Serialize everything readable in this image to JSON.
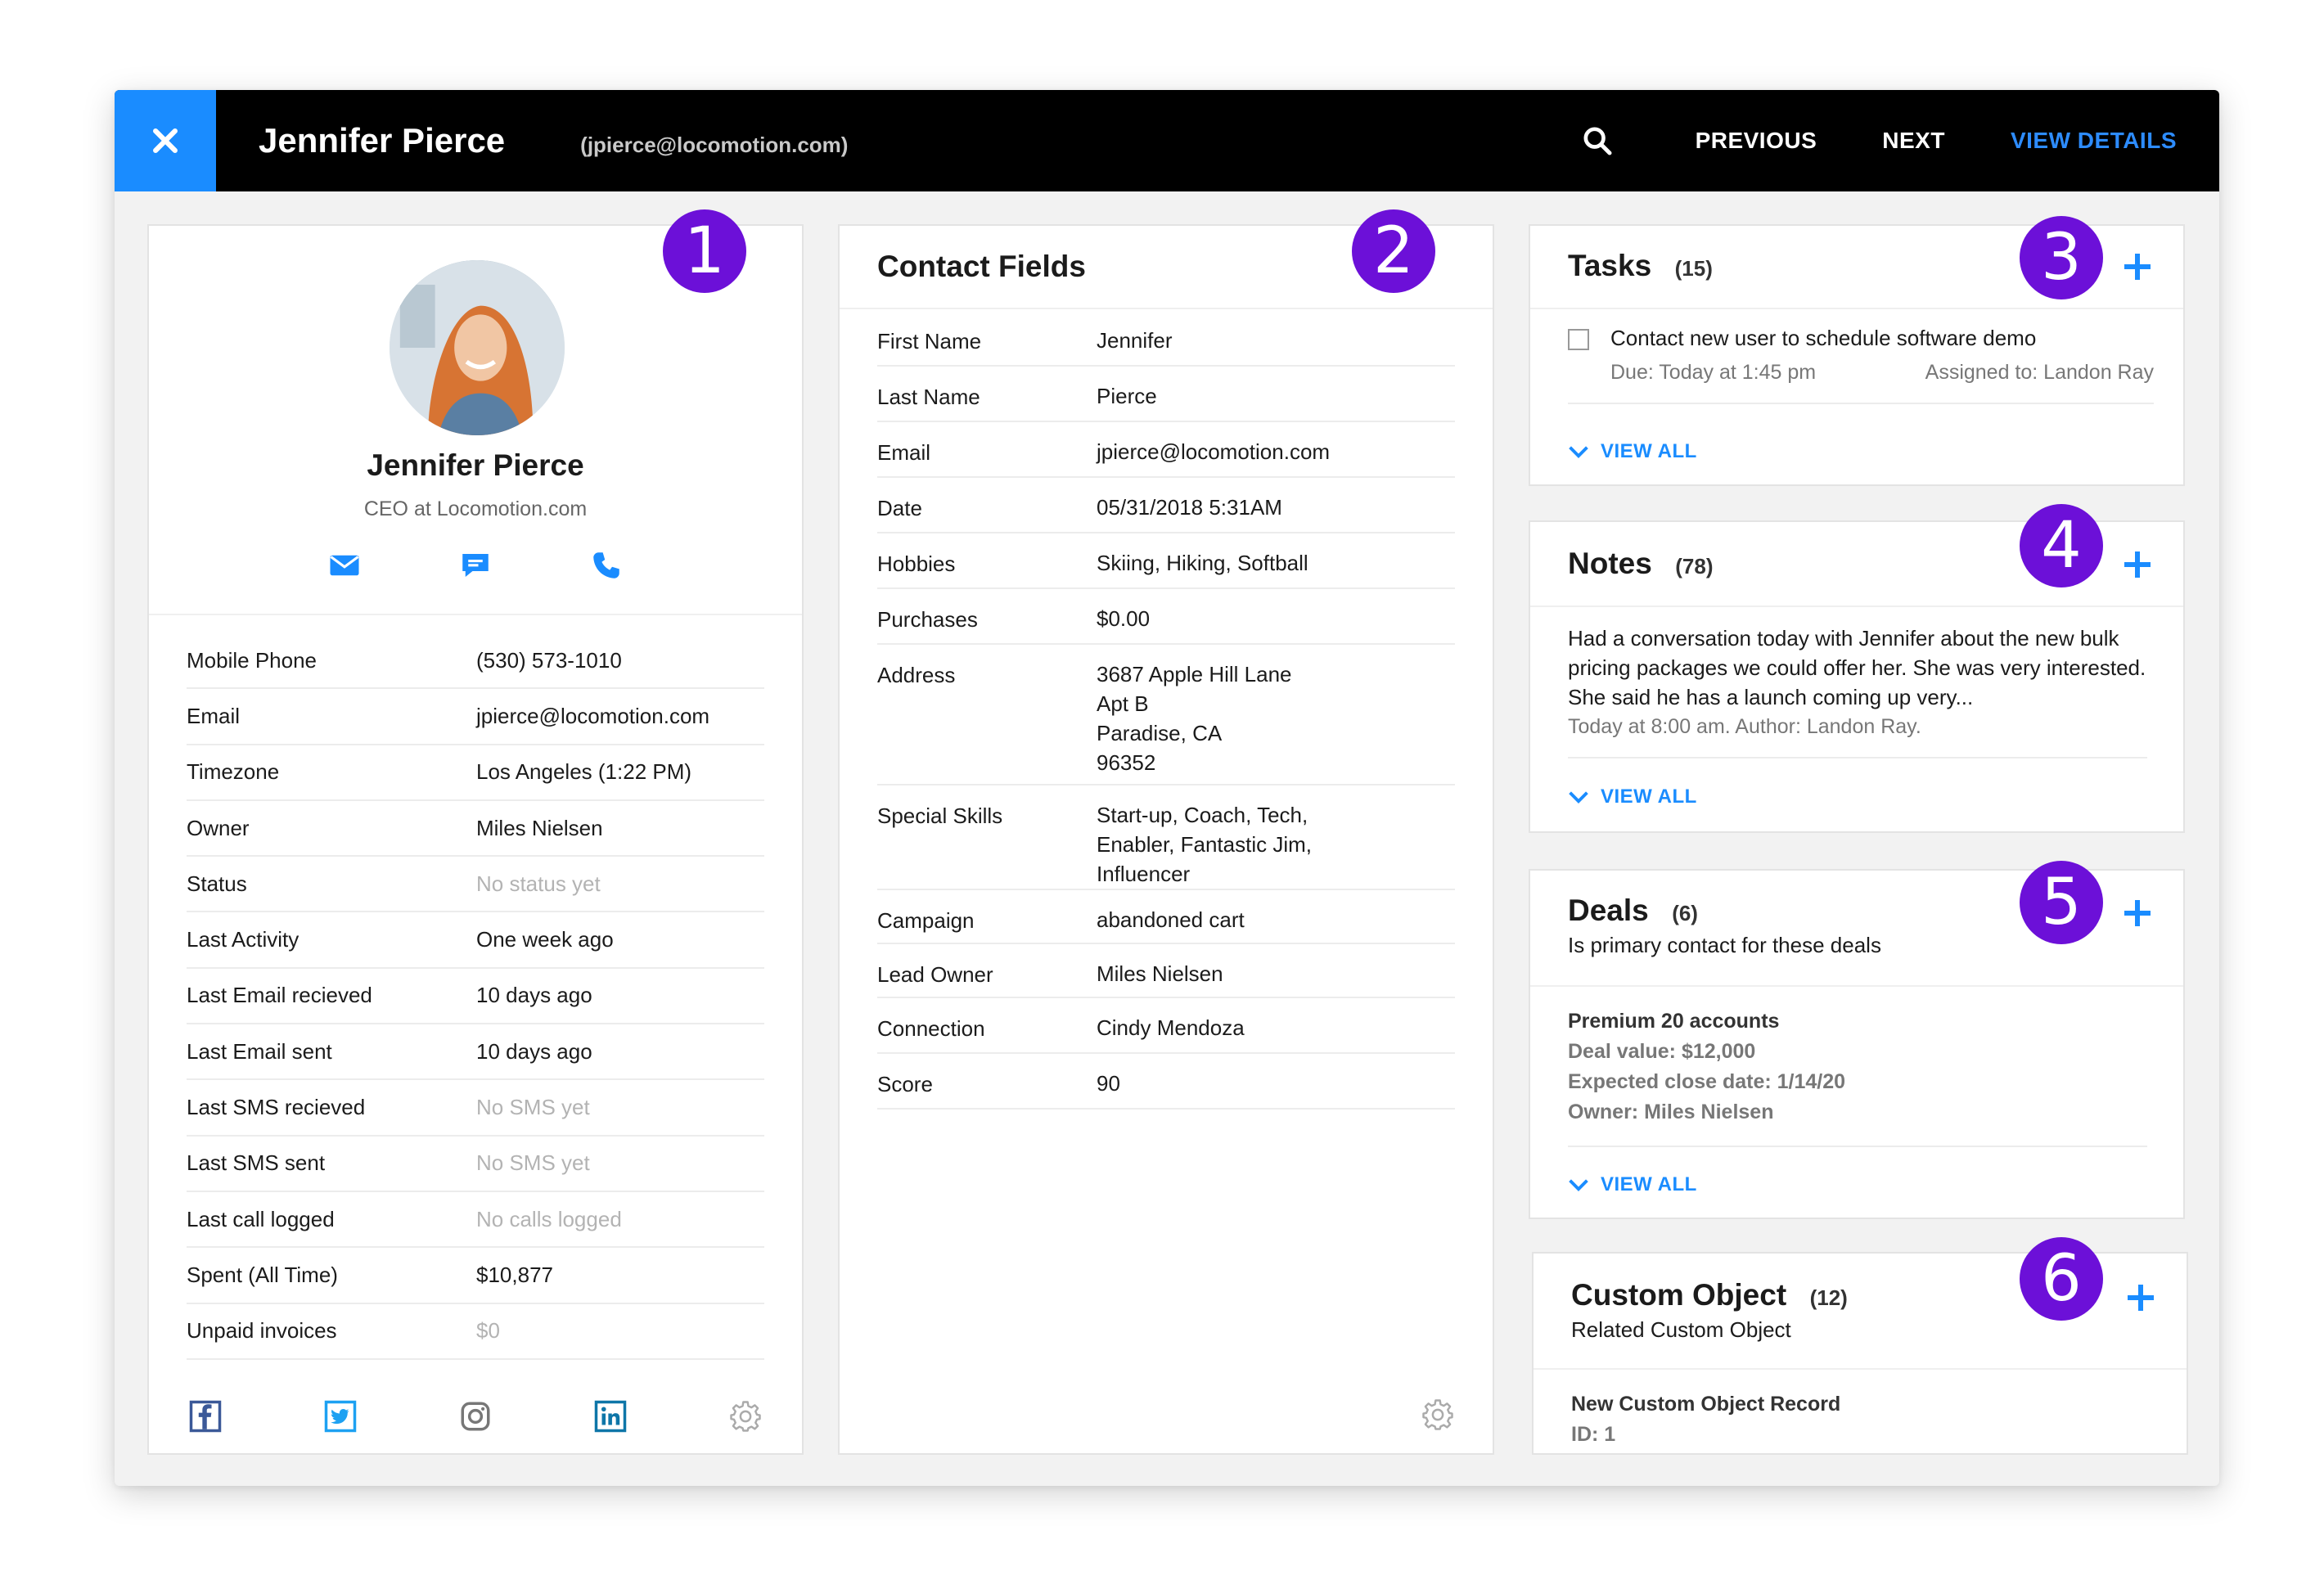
{
  "topbar": {
    "name": "Jennifer Pierce",
    "email": "(jpierce@locomotion.com)",
    "previous": "PREVIOUS",
    "next": "NEXT",
    "view_details": "VIEW DETAILS",
    "accent_color": "#1a8cff"
  },
  "badges": [
    "1",
    "2",
    "3",
    "4",
    "5",
    "6"
  ],
  "profile": {
    "name": "Jennifer Pierce",
    "title": "CEO at Locomotion.com",
    "fields": [
      {
        "label": "Mobile Phone",
        "value": "(530) 573-1010",
        "muted": false
      },
      {
        "label": "Email",
        "value": "jpierce@locomotion.com",
        "muted": false
      },
      {
        "label": "Timezone",
        "value": "Los Angeles (1:22 PM)",
        "muted": false
      },
      {
        "label": "Owner",
        "value": "Miles Nielsen",
        "muted": false
      },
      {
        "label": "Status",
        "value": "No status yet",
        "muted": true
      },
      {
        "label": "Last Activity",
        "value": "One week ago",
        "muted": false
      },
      {
        "label": "Last Email recieved",
        "value": "10 days ago",
        "muted": false
      },
      {
        "label": "Last Email sent",
        "value": "10 days ago",
        "muted": false
      },
      {
        "label": "Last SMS recieved",
        "value": "No SMS yet",
        "muted": true
      },
      {
        "label": "Last SMS sent",
        "value": "No SMS yet",
        "muted": true
      },
      {
        "label": "Last call logged",
        "value": "No calls logged",
        "muted": true
      },
      {
        "label": "Spent (All Time)",
        "value": "$10,877",
        "muted": false
      },
      {
        "label": "Unpaid invoices",
        "value": "$0",
        "muted": true
      }
    ]
  },
  "contact_fields": {
    "title": "Contact Fields",
    "rows": [
      {
        "label": "First Name",
        "value": "Jennifer",
        "h": 68
      },
      {
        "label": "Last Name",
        "value": "Pierce",
        "h": 68
      },
      {
        "label": "Email",
        "value": "jpierce@locomotion.com",
        "h": 68
      },
      {
        "label": "Date",
        "value": "05/31/2018 5:31AM",
        "h": 68
      },
      {
        "label": "Hobbies",
        "value": "Skiing, Hiking, Softball",
        "h": 68
      },
      {
        "label": "Purchases",
        "value": "$0.00",
        "h": 68
      },
      {
        "label": "Address",
        "value": "3687 Apple Hill Lane\nApt B\nParadise, CA\n96352",
        "h": 172
      },
      {
        "label": "Special Skills",
        "value": "Start-up, Coach, Tech,\nEnabler, Fantastic Jim,\nInfluencer",
        "h": 128
      },
      {
        "label": "Campaign",
        "value": "abandoned cart",
        "h": 66
      },
      {
        "label": "Lead Owner",
        "value": "Miles Nielsen",
        "h": 66
      },
      {
        "label": "Connection",
        "value": "Cindy Mendoza",
        "h": 68
      },
      {
        "label": "Score",
        "value": "90",
        "h": 68
      }
    ]
  },
  "tasks": {
    "title": "Tasks",
    "count": "(15)",
    "item_text": "Contact new user to schedule software demo",
    "due": "Due: Today at 1:45 pm",
    "assigned": "Assigned to: Landon Ray",
    "view_all": "VIEW ALL"
  },
  "notes": {
    "title": "Notes",
    "count": "(78)",
    "body": "Had a conversation today with Jennifer about the new bulk pricing packages we could offer her. She was very interested. She said he has a launch coming up very...",
    "meta": "Today at 8:00 am. Author: Landon Ray.",
    "view_all": "VIEW ALL"
  },
  "deals": {
    "title": "Deals",
    "count": "(6)",
    "subtitle": "Is primary contact for these deals",
    "deal_name": "Premium 20 accounts",
    "deal_value": "Deal value: $12,000",
    "close_date": "Expected close date: 1/14/20",
    "owner": "Owner: Miles Nielsen",
    "view_all": "VIEW ALL"
  },
  "custom_object": {
    "title": "Custom Object",
    "count": "(12)",
    "subtitle": "Related Custom Object",
    "record_name": "New Custom Object Record",
    "record_id": "ID: 1"
  }
}
